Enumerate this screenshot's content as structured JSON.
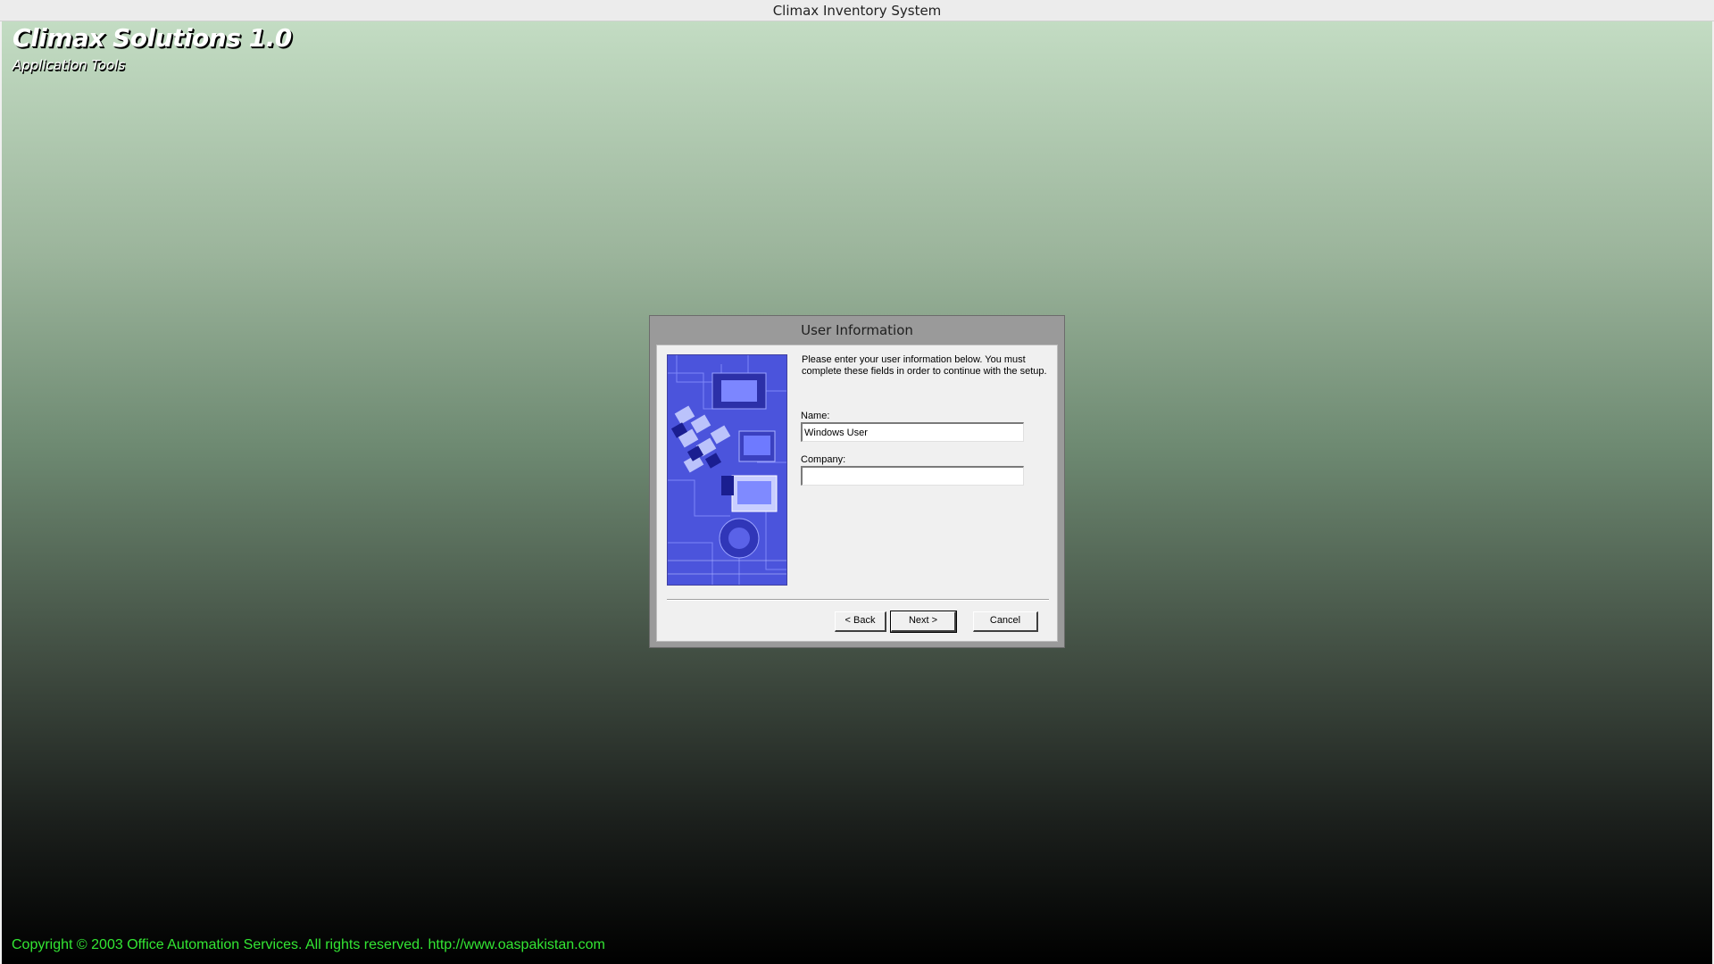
{
  "window": {
    "title": "Climax Inventory System"
  },
  "brand": {
    "title": "Climax Solutions 1.0",
    "subtitle": "Application Tools"
  },
  "footer": {
    "copyright": "Copyright © 2003 Office Automation Services. All rights reserved.",
    "link": "http://www.oaspakistan.com"
  },
  "dialog": {
    "title": "User Information",
    "message": "Please enter your user information below.  You must complete these fields in order to continue with the setup.",
    "name_label": "Name:",
    "name_value": "Windows User",
    "company_label": "Company:",
    "company_value": "",
    "back_label": "< Back",
    "next_label": "Next >",
    "cancel_label": "Cancel"
  },
  "colors": {
    "copyright_text": "#33e633",
    "background_top": "#c3dcc3",
    "background_bottom": "#000000",
    "dialog_frame": "#9a9a9a",
    "dialog_body": "#f0f0f0",
    "side_image": "#4a52e0"
  }
}
